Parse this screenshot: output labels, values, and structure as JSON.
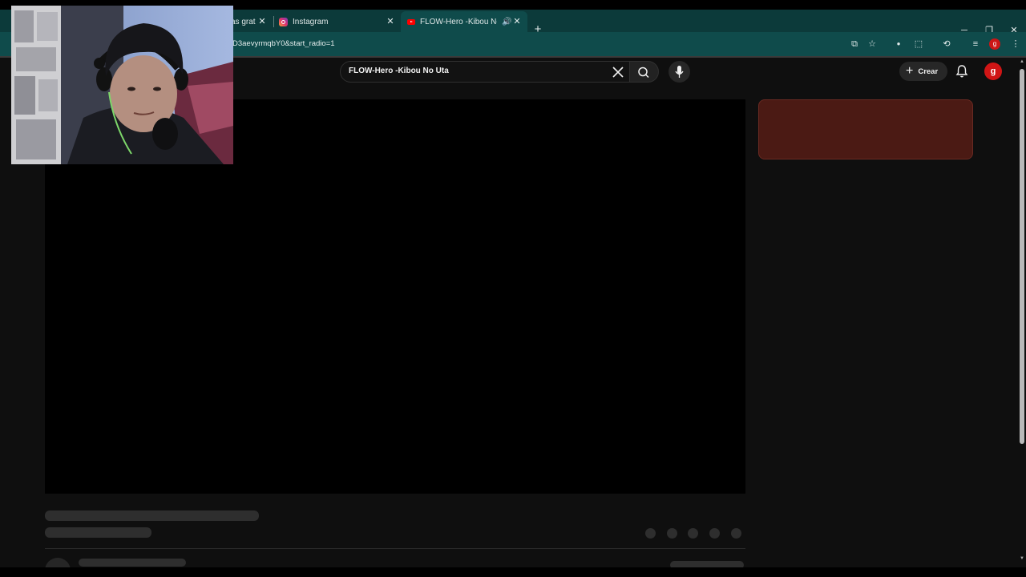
{
  "browser": {
    "tabs": [
      {
        "label": "as grat",
        "state": "partial"
      },
      {
        "label": "Instagram",
        "state": "inactive",
        "icon": "instagram-icon"
      },
      {
        "label": "FLOW-Hero -Kibou No Uta",
        "state": "active",
        "icon": "youtube-icon",
        "audio": "speaker-icon"
      }
    ],
    "close_glyph": "✕",
    "new_tab_glyph": "+",
    "window_controls": {
      "minimize": "─",
      "restore": "❐",
      "close": "✕"
    },
    "url": "D3aevyrmqbY0&start_radio=1",
    "profile_letter": "g",
    "theme_color": "#0f4b4b"
  },
  "youtube": {
    "search": {
      "query": "FLOW-Hero -Kibou No Uta"
    },
    "create_button": {
      "label": "Crear"
    },
    "avatar_letter": "g",
    "brand_color": "#ff0000"
  },
  "webcam": {
    "description_icon": "webcam-overlay"
  }
}
